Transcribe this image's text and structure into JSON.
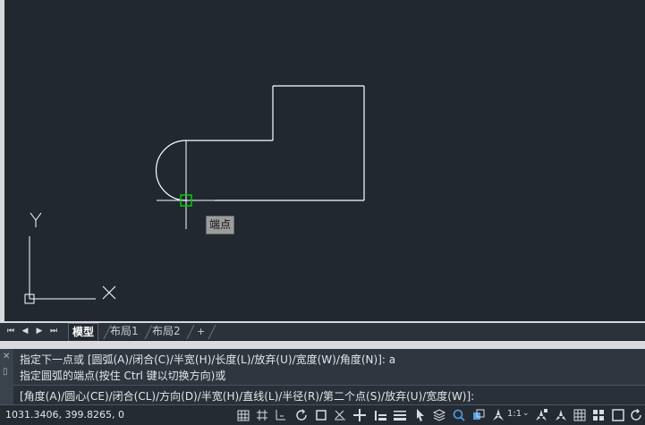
{
  "tooltip": {
    "text": "端点"
  },
  "ucs": {
    "x_label": "X",
    "y_label": "Y"
  },
  "tabs": {
    "nav": [
      "⏮",
      "◀",
      "▶",
      "⏭"
    ],
    "items": [
      {
        "label": "模型",
        "active": true
      },
      {
        "label": "布局1",
        "active": false
      },
      {
        "label": "布局2",
        "active": false
      }
    ],
    "add_label": "+"
  },
  "command": {
    "history": [
      "指定下一点或 [圆弧(A)/闭合(C)/半宽(H)/长度(L)/放弃(U)/宽度(W)/角度(N)]: a",
      "指定圆弧的端点(按住 Ctrl 键以切换方向)或"
    ],
    "prompt": "[角度(A)/圆心(CE)/闭合(CL)/方向(D)/半宽(H)/直线(L)/半径(R)/第二个点(S)/放弃(U)/宽度(W)]:",
    "side_icons": [
      "✕",
      "▯"
    ]
  },
  "status": {
    "coords": "1031.3406, 399.8265, 0",
    "scale": "1:1",
    "icons": [
      "grid-icon",
      "snap-grid-icon",
      "ortho-icon",
      "polar-icon",
      "osnap-icon",
      "otrack-icon",
      "dynamic-ucs-icon",
      "lineweight-icon",
      "transparency-icon",
      "selection-cycle-icon",
      "3d-osnap-icon",
      "annotation-monitor-icon",
      "workspace-icon",
      "annotation-scale-icon",
      "annotate-visibility-icon",
      "auto-scale-icon",
      "units-icon",
      "quick-props-icon",
      "isolate-icon",
      "hardware-accel-icon"
    ]
  },
  "colors": {
    "canvas": "#212830",
    "geometry": "#ffffff",
    "snap_marker": "#00c800"
  }
}
